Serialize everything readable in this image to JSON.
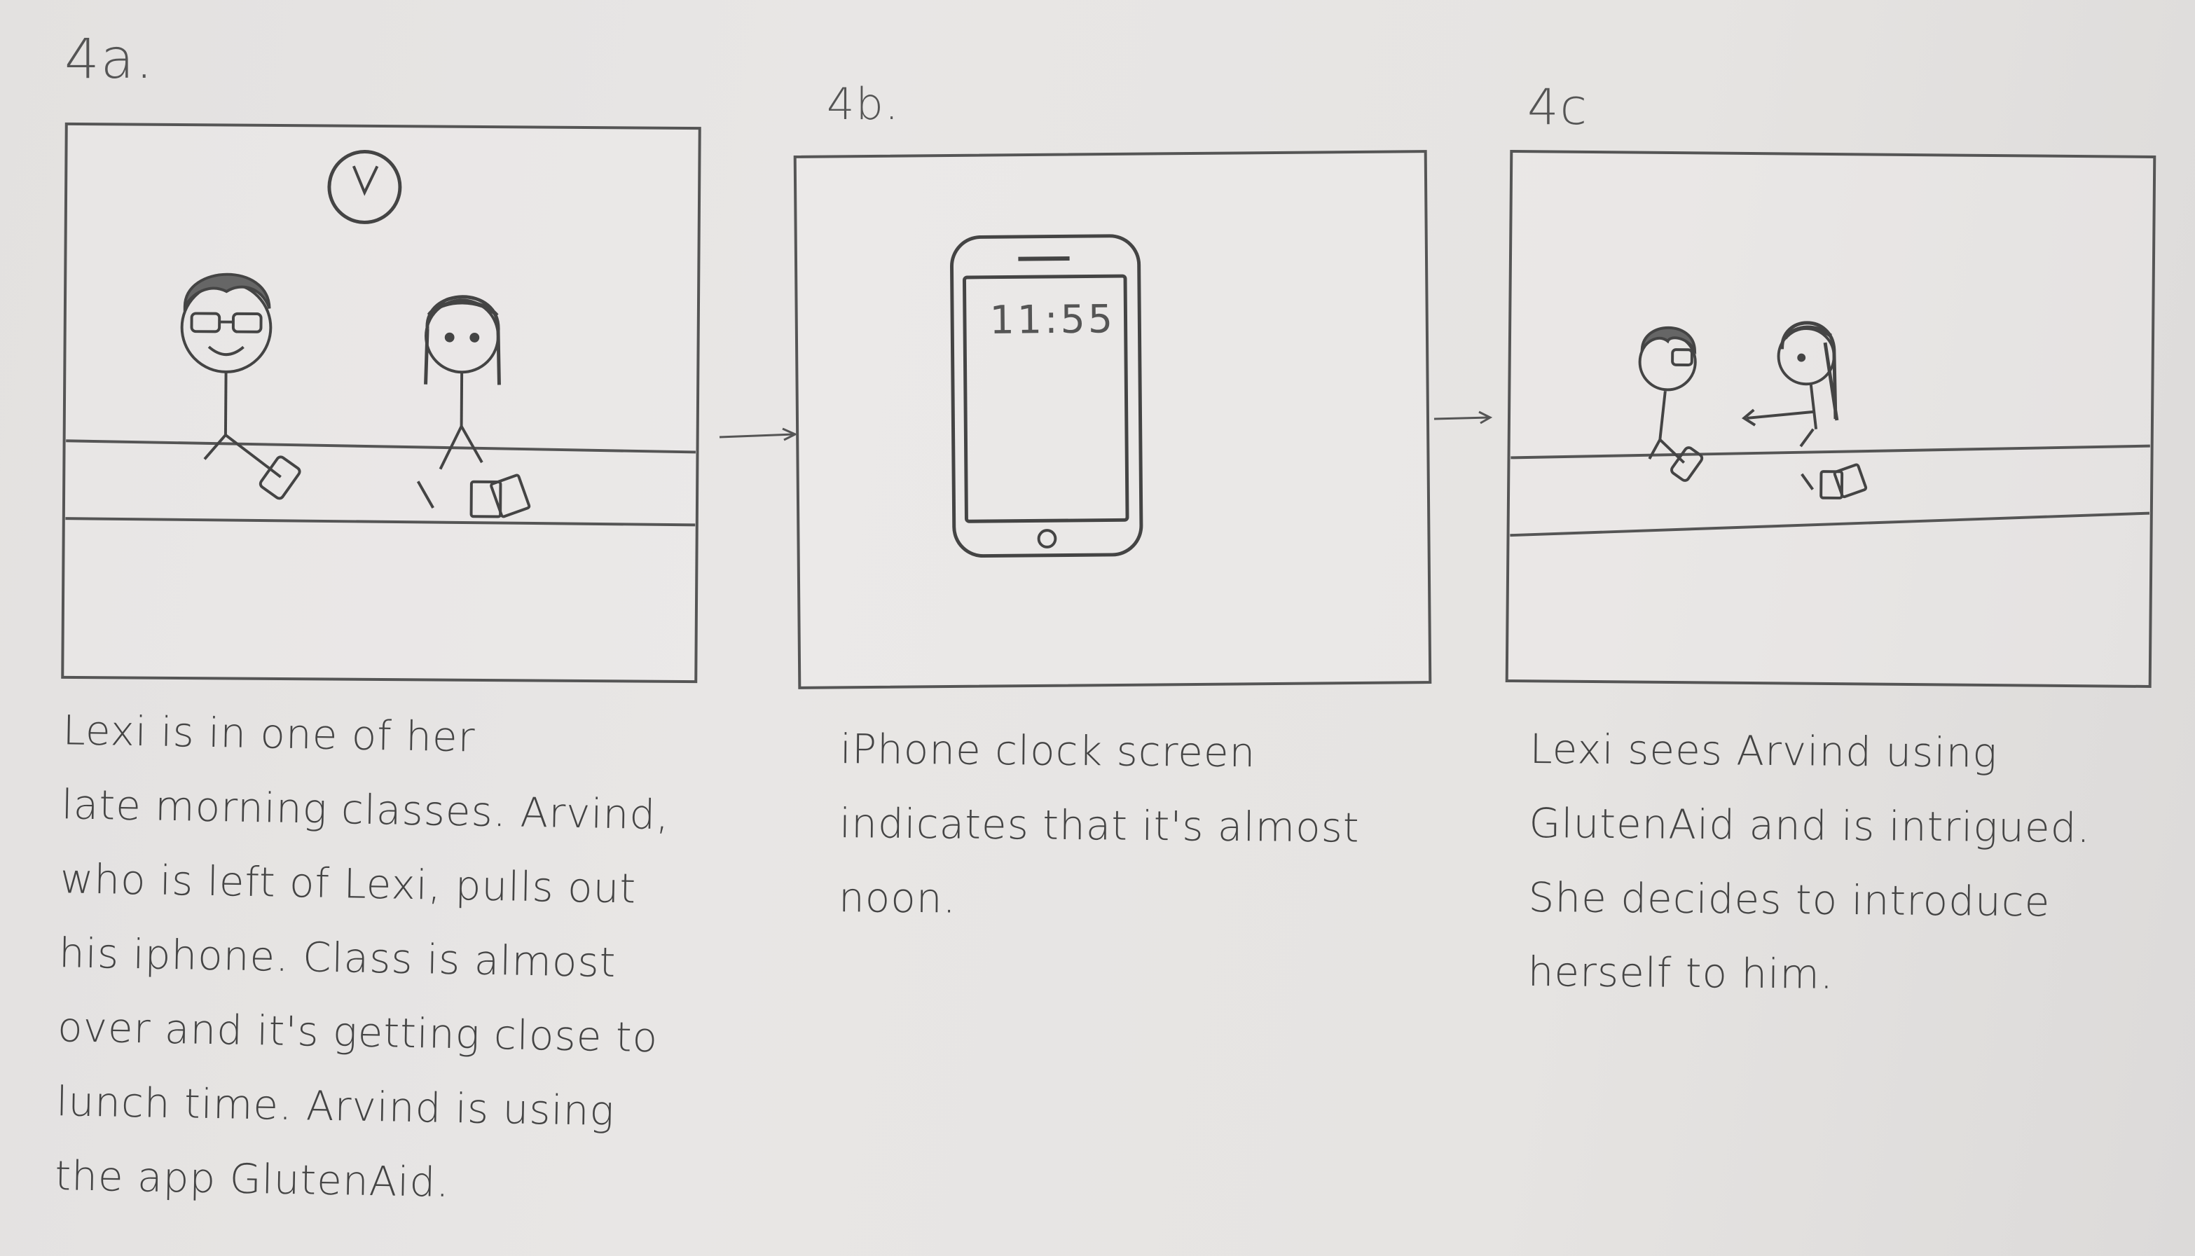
{
  "panels": [
    {
      "label": "4a.",
      "caption": "Lexi is in one of her\nlate morning classes. Arvind,\nwho is left of Lexi, pulls out\nhis iphone. Class is almost\nover and it's getting close to\nlunch time. Arvind is using\nthe app GlutenAid."
    },
    {
      "label": "4b.",
      "caption": "iPhone clock screen\nindicates that it's almost\nnoon.",
      "phone_time": "11:55"
    },
    {
      "label": "4c",
      "caption": "Lexi sees Arvind using\nGlutenAid and is intrigued.\nShe decides to introduce\nherself to him."
    }
  ],
  "style": {
    "pencil_color": "#555555",
    "paper_color": "#e6e4e2"
  }
}
